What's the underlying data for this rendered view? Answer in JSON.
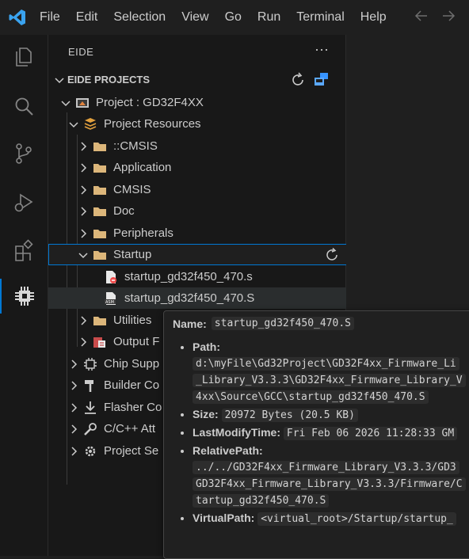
{
  "menu": [
    "File",
    "Edit",
    "Selection",
    "View",
    "Go",
    "Run",
    "Terminal",
    "Help"
  ],
  "sidebar": {
    "title": "EIDE",
    "more": "···",
    "section": "EIDE PROJECTS"
  },
  "tree": {
    "project": "Project : GD32F4XX",
    "resources": "Project Resources",
    "folders": [
      "::CMSIS",
      "Application",
      "CMSIS",
      "Doc",
      "Peripherals"
    ],
    "startup": "Startup",
    "files": [
      "startup_gd32f450_470.s",
      "startup_gd32f450_470.S"
    ],
    "utilities": "Utilities",
    "output": "Output F",
    "others": [
      "Chip Supp",
      "Builder Co",
      "Flasher Co",
      "C/C++ Att",
      "Project Se"
    ]
  },
  "tooltip": {
    "name_label": "Name:",
    "name_value": "startup_gd32f450_470.S",
    "path_label": "Path:",
    "path_lines": [
      "d:\\myFile\\Gd32Project\\GD32F4xx_Firmware_Li",
      "_Library_V3.3.3\\GD32F4xx_Firmware_Library_V",
      "4xx\\Source\\GCC\\startup_gd32f450_470.S"
    ],
    "size_label": "Size:",
    "size_value": "20972 Bytes (20.5 KB)",
    "lmt_label": "LastModifyTime:",
    "lmt_value": "Fri Feb 06 2026 11:28:33 GM",
    "rel_label": "RelativePath:",
    "rel_lines": [
      "../../GD32F4xx_Firmware_Library_V3.3.3/GD3",
      "GD32F4xx_Firmware_Library_V3.3.3/Firmware/C",
      "tartup_gd32f450_470.S"
    ],
    "vp_label": "VirtualPath:",
    "vp_value": "<virtual_root>/Startup/startup_"
  },
  "colors": {
    "accent": "#0078d4",
    "error": "#f14c4c",
    "folder": "#dcb67a"
  }
}
